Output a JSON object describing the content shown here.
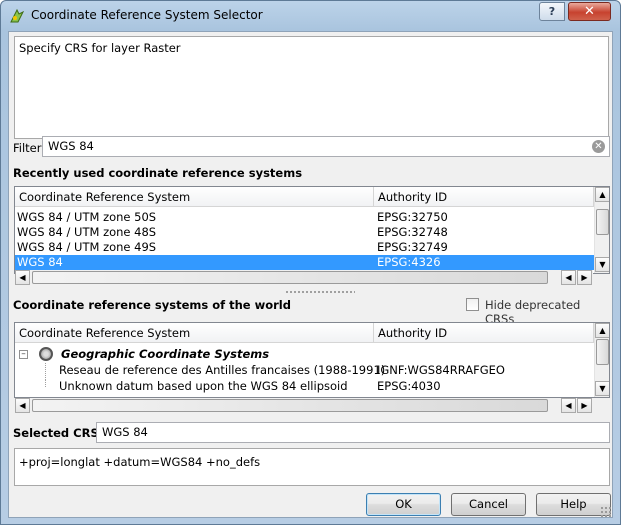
{
  "window": {
    "title": "Coordinate Reference System Selector",
    "help_glyph": "?",
    "close_glyph": "✕"
  },
  "description": "Specify CRS for layer Raster",
  "filter": {
    "label": "Filter",
    "value": "WGS 84"
  },
  "recent": {
    "heading": "Recently used coordinate reference systems",
    "columns": [
      "Coordinate Reference System",
      "Authority ID"
    ],
    "rows": [
      {
        "name": "WGS 84 / UTM zone 50S",
        "id": "EPSG:32750",
        "selected": false
      },
      {
        "name": "WGS 84 / UTM zone 48S",
        "id": "EPSG:32748",
        "selected": false
      },
      {
        "name": "WGS 84 / UTM zone 49S",
        "id": "EPSG:32749",
        "selected": false
      },
      {
        "name": "WGS 84",
        "id": "EPSG:4326",
        "selected": true
      }
    ]
  },
  "world": {
    "heading": "Coordinate reference systems of the world",
    "hide_deprecated_label": "Hide deprecated CRSs",
    "hide_deprecated_checked": false,
    "columns": [
      "Coordinate Reference System",
      "Authority ID"
    ],
    "group": {
      "expander": "–",
      "label": "Geographic Coordinate Systems"
    },
    "rows": [
      {
        "name": "Reseau de reference des Antilles francaises (1988-1991)",
        "id": "IGNF:WGS84RRAFGEO"
      },
      {
        "name": "Unknown datum based upon the WGS 84 ellipsoid",
        "id": "EPSG:4030"
      }
    ]
  },
  "selected_crs": {
    "label": "Selected CRS:",
    "value": "WGS 84"
  },
  "proj_string": "+proj=longlat +datum=WGS84 +no_defs",
  "buttons": {
    "ok": "OK",
    "cancel": "Cancel",
    "help": "Help"
  },
  "scroll_glyphs": {
    "up": "▲",
    "down": "▼",
    "left": "◀",
    "right": "▶"
  },
  "colors": {
    "selection": "#3399ff",
    "title_gradient_top": "#bcd3e9"
  }
}
